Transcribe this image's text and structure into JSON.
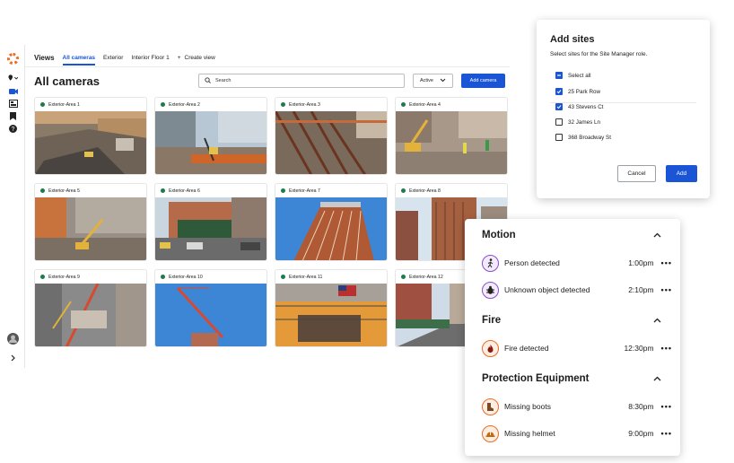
{
  "nav": {
    "views_label": "Views",
    "tabs": [
      "All cameras",
      "Exterior",
      "Interior Floor 1"
    ],
    "create_view_label": "Create view",
    "create_view_icon": "plus-icon"
  },
  "rail_icons": [
    "logo",
    "location-pin-icon",
    "camera-icon",
    "grid-icon",
    "bookmark-icon",
    "help-icon",
    "avatar",
    "expand-icon"
  ],
  "page_title": "All cameras",
  "search": {
    "placeholder": "Search"
  },
  "status_filter": {
    "value": "Active"
  },
  "add_camera_label": "Add camera",
  "cameras": [
    {
      "name": "Exterior-Area 1"
    },
    {
      "name": "Exterior-Area 2"
    },
    {
      "name": "Exterior-Area 3"
    },
    {
      "name": "Exterior-Area 4"
    },
    {
      "name": "Exterior-Area 5"
    },
    {
      "name": "Exterior-Area 6"
    },
    {
      "name": "Exterior-Area 7"
    },
    {
      "name": "Exterior-Area 8"
    },
    {
      "name": "Exterior-Area 9"
    },
    {
      "name": "Exterior-Area 10"
    },
    {
      "name": "Exterior-Area 11"
    },
    {
      "name": "Exterior-Area 12"
    }
  ],
  "add_sites": {
    "title": "Add sites",
    "subtitle": "Select sites for the Site Manager role.",
    "select_all": "Select all",
    "sites": [
      {
        "label": "25 Park Row",
        "checked": true
      },
      {
        "label": "43 Stevens Ct",
        "checked": true
      },
      {
        "label": "32 James Ln",
        "checked": false
      },
      {
        "label": "368 Broadway St",
        "checked": false
      }
    ],
    "cancel_label": "Cancel",
    "add_label": "Add"
  },
  "events": {
    "motion": {
      "title": "Motion",
      "items": [
        {
          "name": "Person detected",
          "time": "1:00pm",
          "icon": "person-walking-icon"
        },
        {
          "name": "Unknown object detected",
          "time": "2:10pm",
          "icon": "bug-icon"
        }
      ]
    },
    "fire": {
      "title": "Fire",
      "items": [
        {
          "name": "Fire detected",
          "time": "12:30pm",
          "icon": "fire-icon"
        }
      ]
    },
    "ppe": {
      "title": "Protection Equipment",
      "items": [
        {
          "name": "Missing boots",
          "time": "8:30pm",
          "icon": "boot-icon"
        },
        {
          "name": "Missing helmet",
          "time": "9:00pm",
          "icon": "helmet-icon"
        }
      ]
    },
    "more_label": "•••"
  },
  "colors": {
    "accent": "#1a55d6",
    "status_dot": "#1e7b4a",
    "motion_icon": "#8a4dcc",
    "fire_icon": "#ef6a1f"
  }
}
